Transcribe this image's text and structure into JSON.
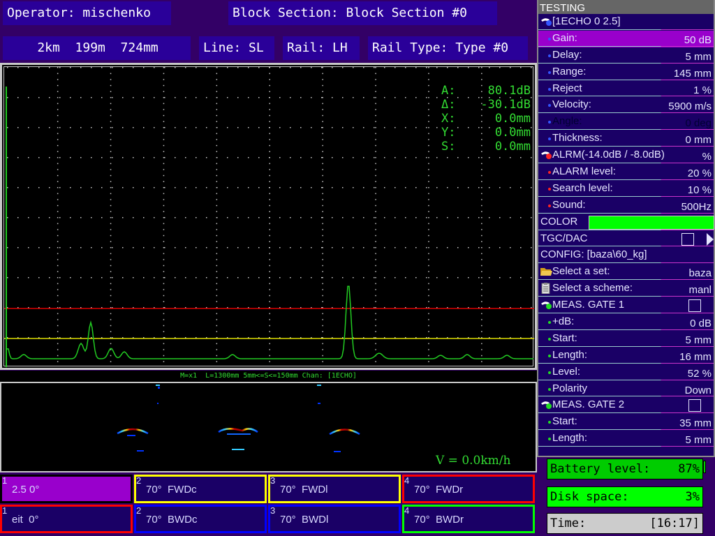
{
  "header": {
    "operator": "Operator: mischenko",
    "block_section": "Block Section: Block Section #0",
    "distance": "    2km  199m  724mm",
    "line": "Line: SL",
    "rail": "Rail: LH",
    "rail_type": "Rail Type: Type #0"
  },
  "ascan": {
    "readout": [
      {
        "label": "A:",
        "value": "80.1dB"
      },
      {
        "label": "Δ:",
        "value": "-30.1dB"
      },
      {
        "label": "X:",
        "value": "0.0mm"
      },
      {
        "label": "Y:",
        "value": "0.0mm"
      },
      {
        "label": "S:",
        "value": "0.0mm"
      }
    ],
    "colors": {
      "trace": "#22cc22",
      "alarm_line": "#dd0000",
      "search_line": "#dddd00",
      "grid": "#c8c8c8"
    }
  },
  "bscan": {
    "info": "M=x1  L=1300mm 5mm<=S<=150mm Chan: [1ECHO]",
    "speed": "V = 0.0km/h"
  },
  "channels": [
    {
      "num": "1",
      "label": "2.5 0°",
      "color": "#000000",
      "selected": true
    },
    {
      "num": "2",
      "label": "70°  FWDc",
      "color": "#ffff00",
      "selected": false
    },
    {
      "num": "3",
      "label": "70°  FWDl",
      "color": "#ffff00",
      "selected": false
    },
    {
      "num": "4",
      "label": "70°  FWDr",
      "color": "#ff0000",
      "selected": false
    },
    {
      "num": "1",
      "label": "eit  0°",
      "color": "#ff0000",
      "selected": false
    },
    {
      "num": "2",
      "label": "70°  BWDc",
      "color": "#0000ff",
      "selected": false
    },
    {
      "num": "3",
      "label": "70°  BWDl",
      "color": "#0000ff",
      "selected": false
    },
    {
      "num": "4",
      "label": "70°  BWDr",
      "color": "#00ff00",
      "selected": false
    }
  ],
  "panel": {
    "title": "TESTING",
    "echo_header": "[1ECHO 0 2.5]",
    "params": [
      {
        "label": "Gain:",
        "value": "50 dB"
      },
      {
        "label": "Delay:",
        "value": "5 mm"
      },
      {
        "label": "Range:",
        "value": "145 mm"
      },
      {
        "label": "Reject",
        "value": "1 %"
      },
      {
        "label": "Velocity:",
        "value": "5900 m/s"
      },
      {
        "label": "Angle:",
        "value": "0 deg"
      },
      {
        "label": "Thickness:",
        "value": "0 mm"
      }
    ],
    "alarm_header": "ALRM(-14.0dB / -8.0dB)",
    "alarm_header_value": "%",
    "alarm_params": [
      {
        "label": "ALARM level:",
        "value": "20 %"
      },
      {
        "label": "Search level:",
        "value": "10 %"
      },
      {
        "label": "Sound:",
        "value": "500Hz"
      }
    ],
    "color_label": "COLOR",
    "color_value": "#00ff00",
    "tgc_label": "TGC/DAC",
    "config_label": "CONFIG: [baza\\60_kg]",
    "select_set_label": "Select a set:",
    "select_set_value": "baza",
    "select_scheme_label": "Select a scheme:",
    "select_scheme_value": "manl",
    "gate1_header": "MEAS. GATE 1",
    "gate1_params": [
      {
        "label": "+dB:",
        "value": "0 dB"
      },
      {
        "label": "Start:",
        "value": "5 mm"
      },
      {
        "label": "Length:",
        "value": "16 mm"
      },
      {
        "label": "Level:",
        "value": "52 %"
      },
      {
        "label": "Polarity",
        "value": "Down"
      }
    ],
    "gate2_header": "MEAS. GATE 2",
    "gate2_params": [
      {
        "label": "Start:",
        "value": "35 mm"
      },
      {
        "label": "Length:",
        "value": "5 mm"
      }
    ]
  },
  "status": {
    "battery_label": "Battery level:",
    "battery_value": "87%",
    "battery_percent": 87,
    "disk_label": "Disk space:",
    "disk_value": "3%",
    "time_label": "Time:",
    "time_value": "[16:17]"
  }
}
